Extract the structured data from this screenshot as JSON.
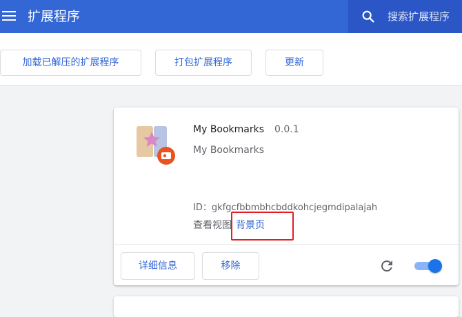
{
  "header": {
    "title": "扩展程序",
    "search_placeholder": "搜索扩展程序",
    "bg_color": "#3367d6"
  },
  "toolbar": {
    "load_unpacked": "加载已解压的扩展程序",
    "pack_extension": "打包扩展程序",
    "update": "更新"
  },
  "extension": {
    "name": "My Bookmarks",
    "version": "0.0.1",
    "description": "My Bookmarks",
    "id_label": "ID：",
    "id_value": "gkfgcfbbmbhcbddkohcjegmdipalajah",
    "views_label": "查看视图",
    "views_link": "背景页",
    "details_button": "详细信息",
    "remove_button": "移除",
    "enabled": true,
    "icon": "star-bookmark-icon",
    "badge_icon": "developer-badge-icon"
  },
  "accent_color": "#1a73e8",
  "highlight_color": "#e51c23"
}
